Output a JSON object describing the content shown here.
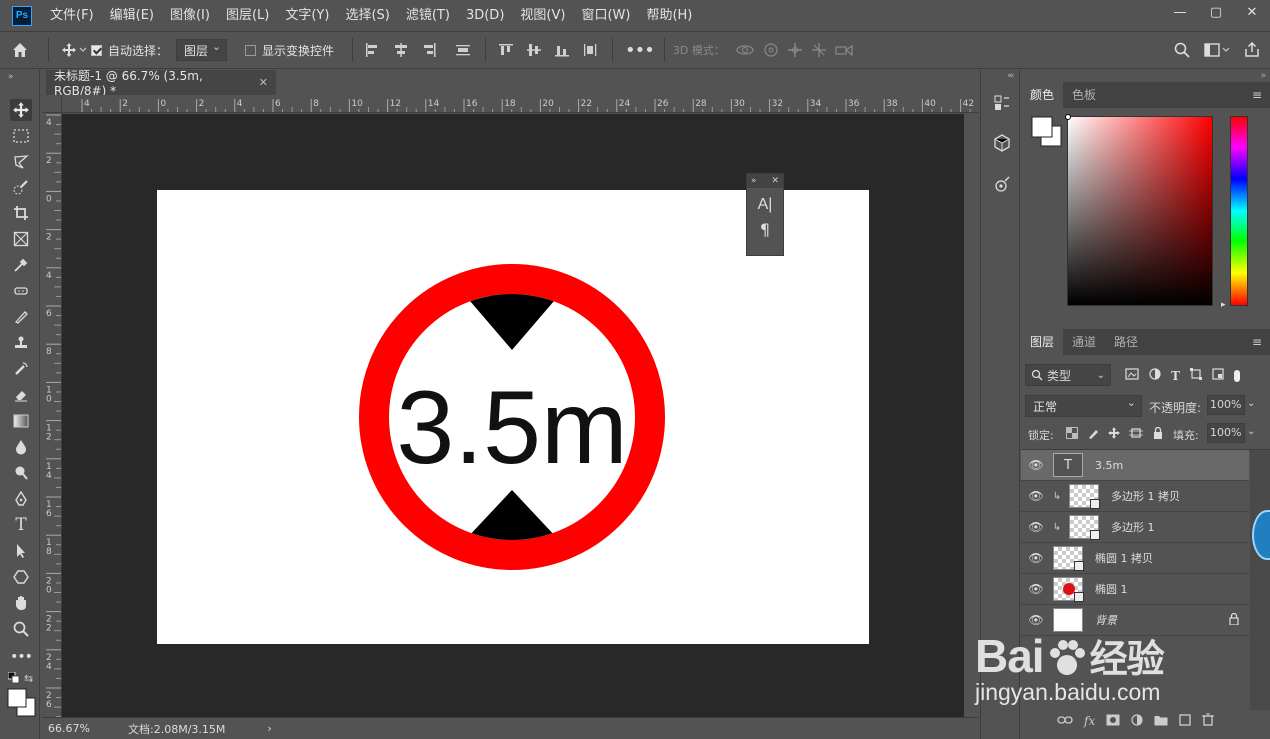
{
  "app": {
    "logo": "Ps"
  },
  "menubar": {
    "items": [
      "文件(F)",
      "编辑(E)",
      "图像(I)",
      "图层(L)",
      "文字(Y)",
      "选择(S)",
      "滤镜(T)",
      "3D(D)",
      "视图(V)",
      "窗口(W)",
      "帮助(H)"
    ]
  },
  "options_bar": {
    "auto_select_label": "自动选择：",
    "auto_select_value": "图层",
    "show_transform_label": "显示变换控件",
    "mode_3d_label": "3D 模式："
  },
  "document": {
    "tab_title": "未标题-1 @ 66.7% (3.5m, RGB/8#) *",
    "sign_text": "3.5m"
  },
  "ruler": {
    "h_labels": [
      "4",
      "2",
      "0",
      "2",
      "4",
      "6",
      "8",
      "10",
      "12",
      "14",
      "16",
      "18",
      "20",
      "22",
      "24",
      "26",
      "28",
      "30",
      "32",
      "34",
      "36",
      "38",
      "40",
      "42"
    ],
    "v_labels": [
      "4",
      "2",
      "0",
      "2",
      "4",
      "6",
      "8",
      "10",
      "12",
      "14",
      "16",
      "18",
      "20",
      "22",
      "24",
      "26"
    ]
  },
  "status": {
    "zoom": "66.67%",
    "doc_info": "文档:2.08M/3.15M",
    "arrow": "›"
  },
  "color_panel": {
    "tabs": [
      "颜色",
      "色板"
    ]
  },
  "layers_panel": {
    "tabs": [
      "图层",
      "通道",
      "路径"
    ],
    "filter_kind": "类型",
    "blend_mode": "正常",
    "opacity_label": "不透明度:",
    "opacity_value": "100%",
    "lock_label": "锁定:",
    "fill_label": "填充:",
    "fill_value": "100%",
    "layers": [
      {
        "name": "3.5m",
        "type": "text",
        "selected": true
      },
      {
        "name": "多边形 1 拷贝",
        "type": "shape",
        "clipped": true
      },
      {
        "name": "多边形 1",
        "type": "shape",
        "clipped": true
      },
      {
        "name": "椭圆 1 拷贝",
        "type": "shape"
      },
      {
        "name": "椭圆 1",
        "type": "shape-red"
      },
      {
        "name": "背景",
        "type": "background",
        "locked": true
      }
    ]
  },
  "colors": {
    "sign_red": "#ff0000",
    "panel_bg": "#535353",
    "work_bg": "#282828",
    "accent_blue": "#31a8ff"
  },
  "watermark": {
    "brand": "Bai",
    "brand2": "经验",
    "url": "jingyan.baidu.com"
  }
}
